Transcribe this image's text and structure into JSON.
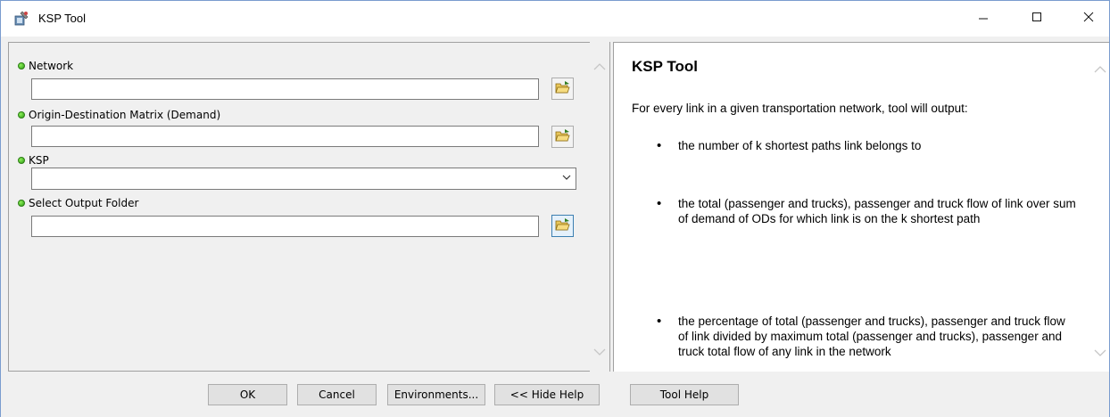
{
  "window": {
    "title": "KSP Tool",
    "controls": {
      "minimize": "—",
      "maximize": "☐",
      "close": "✕"
    }
  },
  "params": [
    {
      "label": "Network",
      "value": ""
    },
    {
      "label": "Origin-Destination Matrix (Demand)",
      "value": ""
    },
    {
      "label": "KSP",
      "value": ""
    },
    {
      "label": "Select Output Folder",
      "value": ""
    }
  ],
  "help": {
    "title": "KSP Tool",
    "intro": "For every link in a given transportation network, tool will output:",
    "bullets": [
      "the number of k shortest paths link belongs to",
      "the total (passenger and trucks), passenger and truck flow of link over sum of demand of ODs for which link is on the k shortest path",
      "the percentage of total (passenger and trucks), passenger and truck flow of link divided by maximum total (passenger and trucks), passenger and truck total flow of any link in the network"
    ]
  },
  "buttons": {
    "ok": "OK",
    "cancel": "Cancel",
    "environments": "Environments...",
    "hide_help": "<< Hide Help",
    "tool_help": "Tool Help"
  },
  "icons": {
    "app": "ksp-tool-icon",
    "folder": "open-folder-icon",
    "status": "required-param-dot-icon"
  }
}
